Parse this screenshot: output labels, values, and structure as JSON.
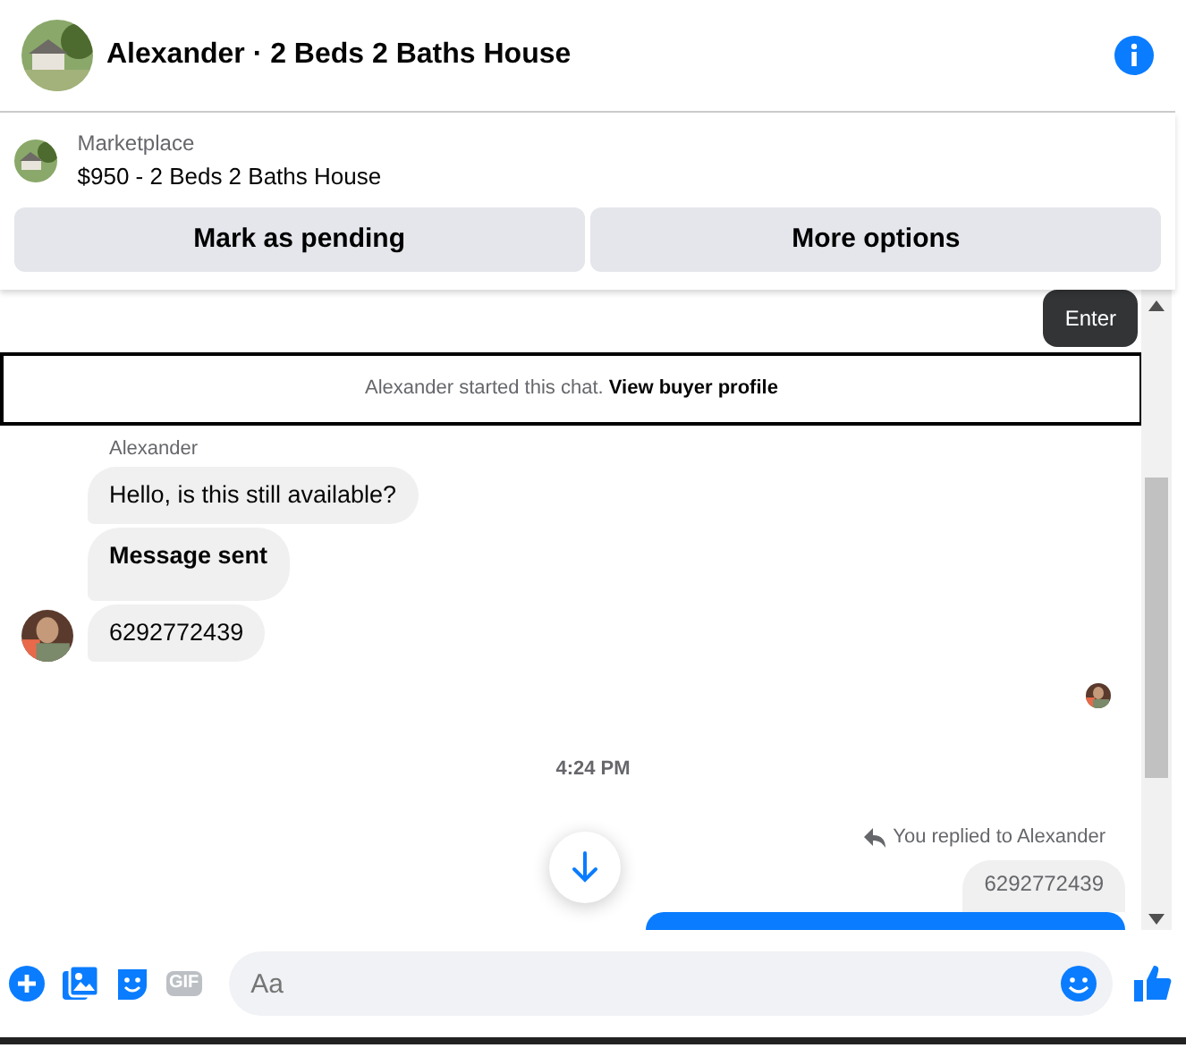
{
  "header": {
    "title": "Alexander · 2 Beds 2 Baths House"
  },
  "listing": {
    "source": "Marketplace",
    "title": "$950 - 2 Beds 2 Baths House"
  },
  "actions": [
    "Mark as pending",
    "More options"
  ],
  "tooltip": "Enter",
  "chat_notice": {
    "text": "Alexander started this chat.",
    "link": "View buyer profile"
  },
  "messages": [
    {
      "kind": "sender",
      "text": "Alexander"
    },
    {
      "kind": "incoming",
      "text": "Hello, is this still available?",
      "bold": false,
      "avatar": false
    },
    {
      "kind": "incoming",
      "text": "Message sent",
      "bold": true,
      "avatar": false
    },
    {
      "kind": "incoming",
      "text": "6292772439",
      "bold": false,
      "avatar": true
    },
    {
      "kind": "seen"
    },
    {
      "kind": "time",
      "text": "4:24 PM"
    },
    {
      "kind": "reply_label",
      "text": "You replied to Alexander"
    },
    {
      "kind": "quoted",
      "text": "6292772439"
    },
    {
      "kind": "outgoing_cut"
    }
  ],
  "composer": {
    "gif_label": "GIF",
    "placeholder": "Aa"
  }
}
